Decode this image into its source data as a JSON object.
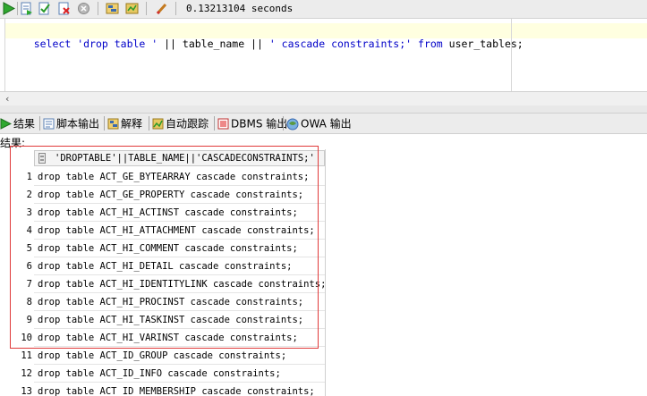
{
  "toolbar": {
    "buttons": [
      "run-icon",
      "run-script-icon",
      "commit-icon",
      "rollback-icon",
      "cancel-icon",
      "explain-plan-icon",
      "autotrace-icon",
      "clear-icon"
    ],
    "elapsed": "0.13213104 seconds"
  },
  "editor": {
    "sql_tokens": [
      {
        "t": "select",
        "k": "kw"
      },
      {
        "t": " ",
        "k": "plain"
      },
      {
        "t": "'drop table '",
        "k": "str"
      },
      {
        "t": " || table_name || ",
        "k": "plain"
      },
      {
        "t": "' cascade constraints;'",
        "k": "str"
      },
      {
        "t": " ",
        "k": "plain"
      },
      {
        "t": "from",
        "k": "kw"
      },
      {
        "t": " user_tables;",
        "k": "plain"
      }
    ]
  },
  "tabs": [
    {
      "label": "结果",
      "icon": "results-icon"
    },
    {
      "label": "脚本输出",
      "icon": "script-output-icon"
    },
    {
      "label": "解释",
      "icon": "explain-icon"
    },
    {
      "label": "自动跟踪",
      "icon": "autotrace-tab-icon"
    },
    {
      "label": "DBMS 输出",
      "icon": "dbms-output-icon"
    },
    {
      "label": "OWA 输出",
      "icon": "owa-output-icon"
    }
  ],
  "result_label": "结果:",
  "grid": {
    "column_header": "'DROPTABLE'||TABLE_NAME||'CASCADECONSTRAINTS;'",
    "rows": [
      {
        "n": "1",
        "v": "drop table ACT_GE_BYTEARRAY cascade constraints;"
      },
      {
        "n": "2",
        "v": "drop table ACT_GE_PROPERTY cascade constraints;"
      },
      {
        "n": "3",
        "v": "drop table ACT_HI_ACTINST cascade constraints;"
      },
      {
        "n": "4",
        "v": "drop table ACT_HI_ATTACHMENT cascade constraints;"
      },
      {
        "n": "5",
        "v": "drop table ACT_HI_COMMENT cascade constraints;"
      },
      {
        "n": "6",
        "v": "drop table ACT_HI_DETAIL cascade constraints;"
      },
      {
        "n": "7",
        "v": "drop table ACT_HI_IDENTITYLINK cascade constraints;"
      },
      {
        "n": "8",
        "v": "drop table ACT_HI_PROCINST cascade constraints;"
      },
      {
        "n": "9",
        "v": "drop table ACT_HI_TASKINST cascade constraints;"
      },
      {
        "n": "10",
        "v": "drop table ACT_HI_VARINST cascade constraints;"
      },
      {
        "n": "11",
        "v": "drop table ACT_ID_GROUP cascade constraints;"
      },
      {
        "n": "12",
        "v": "drop table ACT_ID_INFO cascade constraints;"
      },
      {
        "n": "13",
        "v": "drop table ACT_ID_MEMBERSHIP cascade constraints;"
      }
    ]
  },
  "colors": {
    "keyword": "#0000c8",
    "highlight_border": "#e03a3a",
    "current_line": "#ffffe0"
  }
}
